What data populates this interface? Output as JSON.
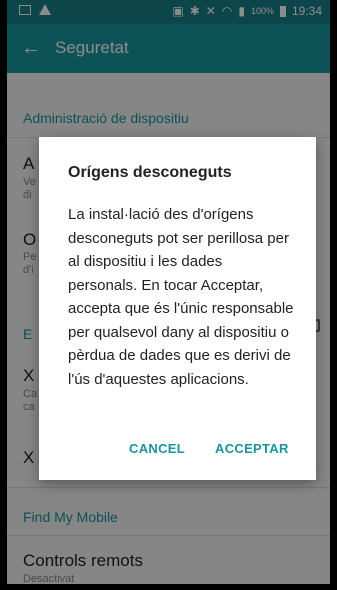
{
  "status_bar": {
    "battery": "100%",
    "time": "19:34"
  },
  "app_bar": {
    "title": "Seguretat"
  },
  "settings": {
    "section_device_admin": "Administració de dispositiu",
    "item1_title": "A",
    "item1_sub1": "Ve",
    "item1_sub2": "di",
    "item2_title": "O",
    "item2_sub1": "Pe",
    "item2_sub2": "d'i",
    "section_e": "E",
    "item3_title": "X",
    "item3_sub1": "Ca",
    "item3_sub2": "ca",
    "item4_title": "X",
    "section_find": "Find My Mobile",
    "item5_title": "Controls remots",
    "item5_sub": "Desactivat"
  },
  "dialog": {
    "title": "Orígens desconeguts",
    "message": "La instal·lació des d'orígens desconeguts pot ser perillosa per al dispositiu i les dades personals. En tocar Acceptar, accepta que és l'únic responsable per qualsevol dany al dispositiu o pèrdua de dades que es derivi de l'ús d'aquestes aplicacions.",
    "cancel": "CANCEL",
    "accept": "ACCEPTAR"
  },
  "colors": {
    "accent": "#19959e",
    "status_bar": "#167f87"
  },
  "icons": [
    "picture-icon",
    "warning-icon",
    "nfc-icon",
    "bluetooth-icon",
    "mute-icon",
    "wifi-icon",
    "signal-icon",
    "battery-icon",
    "back-arrow-icon"
  ]
}
